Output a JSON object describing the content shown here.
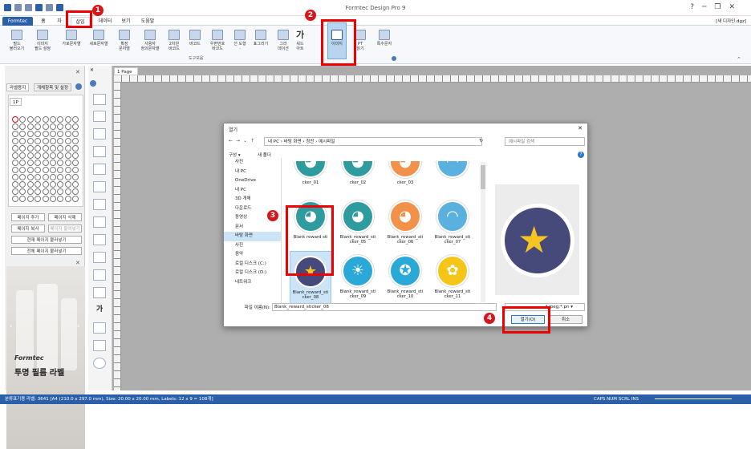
{
  "window": {
    "title": "Formtec Design Pro 9",
    "doc_name": "[새 디자인.dgz]"
  },
  "tabs": [
    {
      "label": "Formtec"
    },
    {
      "label": "홈"
    },
    {
      "label": "자"
    },
    {
      "label": "삽입"
    },
    {
      "label": "데이터"
    },
    {
      "label": "보기"
    },
    {
      "label": "도움말"
    }
  ],
  "ribbon": {
    "buttons": [
      {
        "label": "필드\n불러오기"
      },
      {
        "label": "이미지\n필드 설정"
      },
      {
        "label": "가로문자열"
      },
      {
        "label": "세로문자열"
      },
      {
        "label": "확장\n문자열"
      },
      {
        "label": "사용자\n정의문자열"
      },
      {
        "label": "2차원\n바코드"
      },
      {
        "label": "바코드"
      },
      {
        "label": "우편번호\n바코드"
      },
      {
        "label": "선 도형\n·"
      },
      {
        "label": "표그리기"
      },
      {
        "label": "그라\n데이션"
      },
      {
        "label": "워드\n아트"
      },
      {
        "label": "이미지"
      },
      {
        "label": "PT\n읽기"
      },
      {
        "label": "특수문자"
      }
    ],
    "group_caption": "도구모음"
  },
  "left_panel": {
    "tabs": [
      "라벨용지",
      "개체항목 및 설정"
    ],
    "page_tab": "1P",
    "buttons": [
      "페이지 추가",
      "페이지 삭제",
      "페이지 복사",
      "페이지 붙여넣기",
      "현재 페이지 불러넣기",
      "전체 페이지 불러넣기"
    ],
    "ad_brand": "Formtec",
    "ad_caption": "투명 필름 라벨"
  },
  "canvas": {
    "page_tab": "1 Page"
  },
  "dialog": {
    "title": "열기",
    "address": "내 PC  ›  바탕 화면  ›  칭찬  ›  예시파일",
    "search_placeholder": "예시파일 검색",
    "toolbar": {
      "organize": "구성 ▾",
      "new_folder": "새 폴더"
    },
    "nav_items": [
      "사진",
      "내 PC",
      "OneDrive",
      "내 PC",
      "3D 개체",
      "다운로드",
      "동영상",
      "문서",
      "바탕 화면",
      "사진",
      "음악",
      "로컬 디스크 (C:)",
      "로컬 디스크 (D:)",
      "네트워크"
    ],
    "files": [
      {
        "name": "cker_01",
        "color": "#2e9c9f",
        "icon": "cat-face"
      },
      {
        "name": "cker_02",
        "color": "#2e9c9f",
        "icon": "fox-face"
      },
      {
        "name": "cker_03",
        "color": "#f2924a",
        "icon": "penguin-face"
      },
      {
        "name": "",
        "color": "#5ab0de",
        "icon": "rainbow"
      },
      {
        "name": "Blank reward sti",
        "color": "#2e9c9f",
        "icon": "cat-face"
      },
      {
        "name": "Blank_reward_sti\ncker_05",
        "color": "#2e9c9f",
        "icon": "fox-face"
      },
      {
        "name": "Blank_reward_sti\ncker_06",
        "color": "#f2924a",
        "icon": "penguin-face"
      },
      {
        "name": "Blank_reward_sti\ncker_07",
        "color": "#5ab0de",
        "icon": "rainbow"
      },
      {
        "name": "Blank_reward_sti\ncker_08",
        "color": "#464a7a",
        "icon": "star"
      },
      {
        "name": "Blank_reward_sti\ncker_09",
        "color": "#2aa8d8",
        "icon": "sun"
      },
      {
        "name": "Blank_reward_sti\ncker_10",
        "color": "#2aa8d8",
        "icon": "medal"
      },
      {
        "name": "Blank_reward_sti\ncker_11",
        "color": "#f5c518",
        "icon": "flower"
      },
      {
        "name": "",
        "color": "#464a7a",
        "icon": "crown"
      },
      {
        "name": "",
        "color": "#d22e2e",
        "icon": "crown"
      },
      {
        "name": "",
        "color": "#5ab0de",
        "icon": "heart"
      },
      {
        "name": "",
        "color": "#f2924a",
        "icon": "apple"
      }
    ],
    "filename_label": "파일 이름(N):",
    "filename_value": "Blank_reward_sticker_08",
    "filetype": "*.jpeg;*.pn ▾",
    "open_button": "열기(O)",
    "cancel_button": "취소"
  },
  "annotations": [
    "1",
    "2",
    "3",
    "4"
  ],
  "status": {
    "text": "분류표기용 라벨: 3641 [A4 (210.0 x 297.0 mm), Size: 20.00 x 20.00 mm, Labels: 12 x 9 = 108개]",
    "indicators": "CAPS  NUM  SCRL  INS"
  }
}
